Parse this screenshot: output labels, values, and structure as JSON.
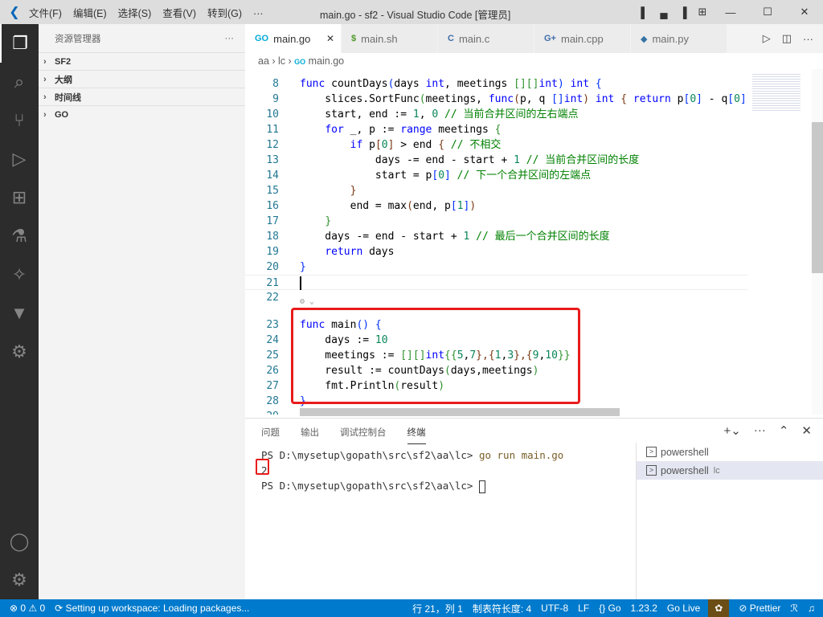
{
  "titlebar": {
    "menus": [
      "文件(F)",
      "编辑(E)",
      "选择(S)",
      "查看(V)",
      "转到(G)",
      "···"
    ],
    "title": "main.go - sf2 - Visual Studio Code [管理员]"
  },
  "activity": [
    "files-icon",
    "search-icon",
    "source-control-icon",
    "run-debug-icon",
    "extensions-icon",
    "testing-icon",
    "remote-icon",
    "gitlens-icon",
    "docker-icon"
  ],
  "sidebar": {
    "title": "资源管理器",
    "more": "···",
    "sections": [
      "SF2",
      "大纲",
      "时间线",
      "GO"
    ]
  },
  "tabs": [
    {
      "label": "main.go",
      "icon": "GO",
      "color": "#00acd7",
      "active": true
    },
    {
      "label": "main.sh",
      "icon": "$",
      "color": "#4d9a28"
    },
    {
      "label": "main.c",
      "icon": "C",
      "color": "#3f6ea8"
    },
    {
      "label": "main.cpp",
      "icon": "G+",
      "color": "#3f6ea8"
    },
    {
      "label": "main.py",
      "icon": "◆",
      "color": "#3572a5"
    }
  ],
  "breadcrumb": [
    "aa",
    "lc",
    "main.go"
  ],
  "code": [
    {
      "n": "8",
      "t": [
        [
          "func ",
          "kw"
        ],
        [
          "countDays",
          "pl"
        ],
        [
          "(",
          "b1"
        ],
        [
          "days ",
          "pl"
        ],
        [
          "int",
          "kw"
        ],
        [
          ", meetings ",
          "pl"
        ],
        [
          "[][]",
          "b2"
        ],
        [
          "int",
          "kw"
        ],
        [
          ")",
          "b1"
        ],
        [
          " ",
          "pl"
        ],
        [
          "int",
          "kw"
        ],
        [
          " {",
          "b1"
        ]
      ]
    },
    {
      "n": "9",
      "t": [
        [
          "    slices.SortFunc",
          "pl"
        ],
        [
          "(",
          "b2"
        ],
        [
          "meetings, ",
          "pl"
        ],
        [
          "func",
          "kw"
        ],
        [
          "(",
          "b3"
        ],
        [
          "p, q ",
          "pl"
        ],
        [
          "[]",
          "b1"
        ],
        [
          "int",
          "kw"
        ],
        [
          ")",
          "b3"
        ],
        [
          " ",
          "pl"
        ],
        [
          "int",
          "kw"
        ],
        [
          " { ",
          "b3"
        ],
        [
          "return ",
          "kw"
        ],
        [
          "p",
          "pl"
        ],
        [
          "[",
          "b1"
        ],
        [
          "0",
          "num"
        ],
        [
          "]",
          "b1"
        ],
        [
          " - q",
          "pl"
        ],
        [
          "[",
          "b1"
        ],
        [
          "0",
          "num"
        ],
        [
          "]",
          "b1"
        ],
        [
          " }",
          "b3"
        ],
        [
          ")",
          "b2"
        ]
      ]
    },
    {
      "n": "10",
      "t": [
        [
          "    start, end := ",
          "pl"
        ],
        [
          "1",
          "num"
        ],
        [
          ", ",
          "pl"
        ],
        [
          "0",
          "num"
        ],
        [
          " // 当前合并区间的左右端点",
          "cm"
        ]
      ]
    },
    {
      "n": "11",
      "t": [
        [
          "    ",
          "pl"
        ],
        [
          "for",
          "kw"
        ],
        [
          " _, p := ",
          "pl"
        ],
        [
          "range",
          "kw"
        ],
        [
          " meetings ",
          "pl"
        ],
        [
          "{",
          "b2"
        ]
      ]
    },
    {
      "n": "12",
      "t": [
        [
          "        ",
          "pl"
        ],
        [
          "if",
          "kw"
        ],
        [
          " p",
          "pl"
        ],
        [
          "[",
          "b3"
        ],
        [
          "0",
          "num"
        ],
        [
          "]",
          "b3"
        ],
        [
          " > end ",
          "pl"
        ],
        [
          "{",
          "b3"
        ],
        [
          " // 不相交",
          "cm"
        ]
      ]
    },
    {
      "n": "13",
      "t": [
        [
          "            days -= end - start + ",
          "pl"
        ],
        [
          "1",
          "num"
        ],
        [
          " // 当前合并区间的长度",
          "cm"
        ]
      ]
    },
    {
      "n": "14",
      "t": [
        [
          "            start = p",
          "pl"
        ],
        [
          "[",
          "b1"
        ],
        [
          "0",
          "num"
        ],
        [
          "]",
          "b1"
        ],
        [
          " // 下一个合并区间的左端点",
          "cm"
        ]
      ]
    },
    {
      "n": "15",
      "t": [
        [
          "        ",
          "pl"
        ],
        [
          "}",
          "b3"
        ]
      ]
    },
    {
      "n": "16",
      "t": [
        [
          "        end = max",
          "pl"
        ],
        [
          "(",
          "b3"
        ],
        [
          "end, p",
          "pl"
        ],
        [
          "[",
          "b1"
        ],
        [
          "1",
          "num"
        ],
        [
          "]",
          "b1"
        ],
        [
          ")",
          "b3"
        ]
      ]
    },
    {
      "n": "17",
      "t": [
        [
          "    ",
          "pl"
        ],
        [
          "}",
          "b2"
        ]
      ]
    },
    {
      "n": "18",
      "t": [
        [
          "    days -= end - start + ",
          "pl"
        ],
        [
          "1",
          "num"
        ],
        [
          " // 最后一个合并区间的长度",
          "cm"
        ]
      ]
    },
    {
      "n": "19",
      "t": [
        [
          "    ",
          "pl"
        ],
        [
          "return",
          "kw"
        ],
        [
          " days",
          "pl"
        ]
      ]
    },
    {
      "n": "20",
      "t": [
        [
          "}",
          "b1"
        ]
      ]
    },
    {
      "n": "21",
      "t": []
    },
    {
      "n": "22",
      "t": []
    },
    {
      "n": "23",
      "t": [
        [
          "func ",
          "kw"
        ],
        [
          "main",
          "pl"
        ],
        [
          "()",
          "b1"
        ],
        [
          " {",
          "b1"
        ]
      ]
    },
    {
      "n": "24",
      "t": [
        [
          "    days := ",
          "pl"
        ],
        [
          "10",
          "num"
        ]
      ]
    },
    {
      "n": "25",
      "t": [
        [
          "    meetings := ",
          "pl"
        ],
        [
          "[][]",
          "b2"
        ],
        [
          "int",
          "kw"
        ],
        [
          "{{",
          "b2"
        ],
        [
          "5",
          "num"
        ],
        [
          ",",
          "pl"
        ],
        [
          "7",
          "num"
        ],
        [
          "}",
          "b3"
        ],
        [
          ",{",
          "b3"
        ],
        [
          "1",
          "num"
        ],
        [
          ",",
          "pl"
        ],
        [
          "3",
          "num"
        ],
        [
          "}",
          "b3"
        ],
        [
          ",{",
          "b3"
        ],
        [
          "9",
          "num"
        ],
        [
          ",",
          "pl"
        ],
        [
          "10",
          "num"
        ],
        [
          "}}",
          "b2"
        ]
      ]
    },
    {
      "n": "26",
      "t": [
        [
          "    result := countDays",
          "pl"
        ],
        [
          "(",
          "b2"
        ],
        [
          "days,meetings",
          "pl"
        ],
        [
          ")",
          "b2"
        ]
      ]
    },
    {
      "n": "27",
      "t": [
        [
          "    fmt.Println",
          "pl"
        ],
        [
          "(",
          "b2"
        ],
        [
          "result",
          "pl"
        ],
        [
          ")",
          "b2"
        ]
      ]
    },
    {
      "n": "28",
      "t": [
        [
          "}",
          "b1"
        ]
      ]
    },
    {
      "n": "29",
      "t": []
    }
  ],
  "panel": {
    "tabs": [
      "问题",
      "输出",
      "调试控制台",
      "终端"
    ],
    "active": "终端",
    "terminal": {
      "prompt1": "PS D:\\mysetup\\gopath\\src\\sf2\\aa\\lc> ",
      "cmd": "go run main.go",
      "output": "2",
      "prompt2": "PS D:\\mysetup\\gopath\\src\\sf2\\aa\\lc> "
    },
    "terminals": [
      {
        "label": "powershell",
        "sub": ""
      },
      {
        "label": "powershell",
        "sub": "lc",
        "selected": true
      }
    ]
  },
  "status": {
    "problems": "⊗ 0 ⚠ 0",
    "task": "⟳ Setting up workspace: Loading packages...",
    "position": "行 21，列 1",
    "tabsize": "制表符长度: 4",
    "encoding": "UTF-8",
    "eol": "LF",
    "lang": "{} Go",
    "version": "1.23.2",
    "golive": "Go Live",
    "prettier": "⊘ Prettier"
  },
  "colors": {
    "accent": "#007acc",
    "highlight": "#e81b1b"
  }
}
